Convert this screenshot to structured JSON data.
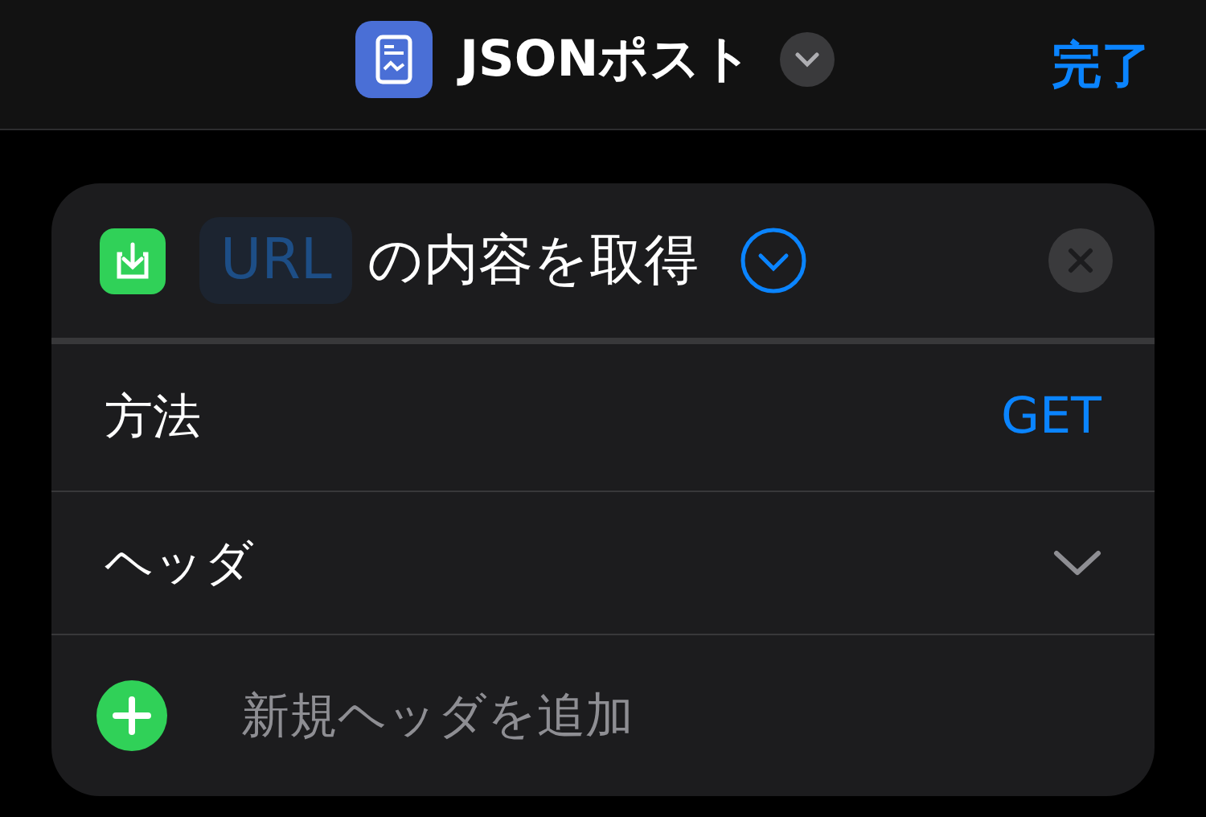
{
  "navbar": {
    "title": "JSONポスト",
    "done": "完了"
  },
  "action": {
    "variable": "URL",
    "title": "の内容を取得"
  },
  "rows": [
    {
      "kind": "value",
      "label": "方法",
      "value": "GET"
    },
    {
      "kind": "disclosure",
      "label": "ヘッダ"
    },
    {
      "kind": "add",
      "label": "新規ヘッダを追加"
    }
  ]
}
